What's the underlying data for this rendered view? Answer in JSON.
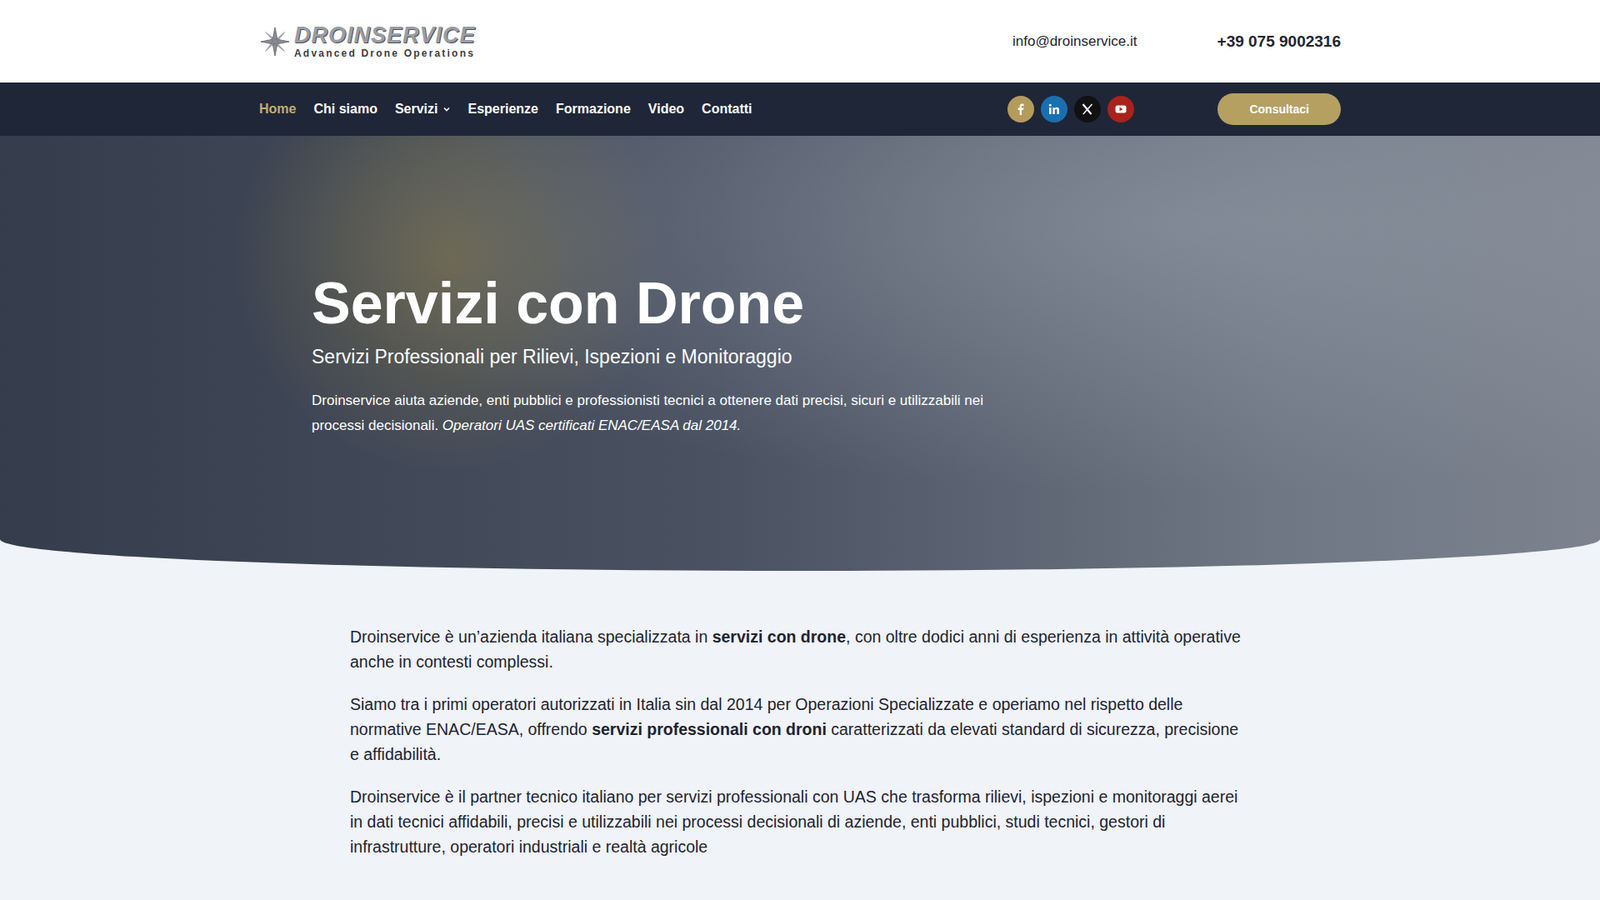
{
  "logo": {
    "name": "DROINSERVICE",
    "tagline": "Advanced Drone Operations"
  },
  "contact": {
    "email": "info@droinservice.it",
    "phone": "+39 075 9002316"
  },
  "nav": [
    {
      "label": "Home",
      "selected": true,
      "dropdown": false
    },
    {
      "label": "Chi siamo",
      "selected": false,
      "dropdown": false
    },
    {
      "label": "Servizi",
      "selected": false,
      "dropdown": true
    },
    {
      "label": "Esperienze",
      "selected": false,
      "dropdown": false
    },
    {
      "label": "Formazione",
      "selected": false,
      "dropdown": false
    },
    {
      "label": "Video",
      "selected": false,
      "dropdown": false
    },
    {
      "label": "Contatti",
      "selected": false,
      "dropdown": false
    }
  ],
  "social": [
    {
      "kind": "facebook",
      "color": "#b39b5b"
    },
    {
      "kind": "linkedin",
      "color": "#1a6fb0"
    },
    {
      "kind": "x",
      "color": "#111111"
    },
    {
      "kind": "youtube",
      "color": "#a8231b"
    }
  ],
  "cta": "Consultaci",
  "hero": {
    "title": "Servizi con Drone",
    "subtitle": "Servizi Professionali per Rilievi, Ispezioni e Monitoraggio",
    "text": "Droinservice aiuta aziende, enti pubblici e professionisti tecnici a ottenere dati precisi, sicuri e utilizzabili nei processi decisionali. ",
    "emphasis": "Operatori UAS certificati ENAC/EASA dal 2014."
  },
  "intro": [
    [
      {
        "text": "Droinservice è un’azienda italiana specializzata in ",
        "bold": false
      },
      {
        "text": "servizi con drone",
        "bold": true
      },
      {
        "text": ", con oltre dodici anni di esperienza in attività operative anche in contesti complessi.",
        "bold": false
      }
    ],
    [
      {
        "text": "Siamo tra i primi operatori autorizzati in Italia sin dal 2014 per Operazioni Specializzate e operiamo nel rispetto delle normative ENAC/EASA, offrendo ",
        "bold": false
      },
      {
        "text": "servizi professionali con droni",
        "bold": true
      },
      {
        "text": " caratterizzati da elevati standard di sicurezza, precisione e affidabilità.",
        "bold": false
      }
    ],
    [
      {
        "text": "Droinservice è il partner tecnico italiano per servizi professionali con UAS che trasforma rilievi, ispezioni e monitoraggi aerei in dati tecnici affidabili, precisi e utilizzabili nei processi decisionali di aziende, enti pubblici, studi tecnici, gestori di infrastrutture, operatori industriali e realtà agricole",
        "bold": false
      }
    ]
  ]
}
